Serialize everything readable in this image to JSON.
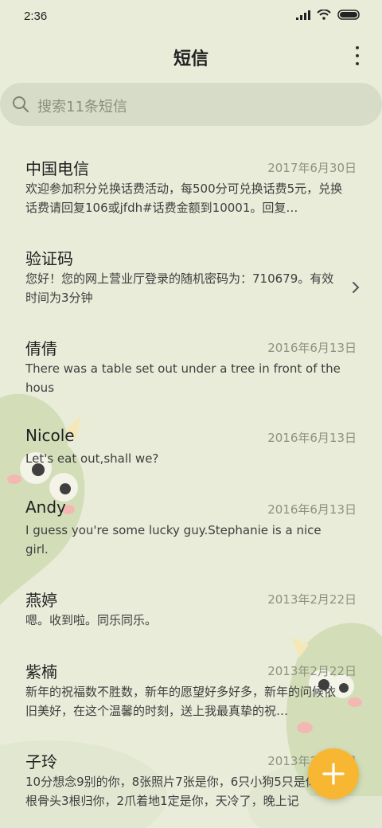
{
  "status": {
    "time": "2:36"
  },
  "header": {
    "title": "短信"
  },
  "search": {
    "placeholder": "搜索11条短信"
  },
  "messages": [
    {
      "name": "中国电信",
      "date": "2017年6月30日",
      "preview": "欢迎参加积分兑换话费活动，每500分可兑换话费5元，兑换话费请回复106或jfdh#话费金额到10001。回复…"
    },
    {
      "name": "验证码",
      "date": "",
      "preview": "您好！您的网上营业厅登录的随机密码为：710679。有效时间为3分钟"
    },
    {
      "name": "倩倩",
      "date": "2016年6月13日",
      "preview": "There was a table set out under a tree in front of the hous"
    },
    {
      "name": "Nicole",
      "date": "2016年6月13日",
      "preview": "Let's eat out,shall we?"
    },
    {
      "name": "Andy",
      "date": "2016年6月13日",
      "preview": "I guess you're some lucky guy.Stephanie is a nice girl."
    },
    {
      "name": "燕婷",
      "date": "2013年2月22日",
      "preview": "嗯。收到啦。同乐同乐。"
    },
    {
      "name": "紫楠",
      "date": "2013年2月22日",
      "preview": "新年的祝福数不胜数，新年的愿望好多好多，新年的问候依旧美好，在这个温馨的时刻，送上我最真挚的祝…"
    },
    {
      "name": "子玲",
      "date": "2013年2月22日",
      "preview": "10分想念9别的你，8张照片7张是你，6只小狗5只是你，4根骨头3根归你，2爪着地1定是你，天冷了，晚上记"
    }
  ],
  "colors": {
    "background": "#e9ecd9",
    "search_bg": "#d7dcc8",
    "accent": "#f7b733",
    "date_text": "#8d927f"
  },
  "icons": {
    "compose": "plus-icon",
    "more": "more-vertical-icon",
    "search": "search-icon",
    "detail": "chevron-right-icon"
  }
}
